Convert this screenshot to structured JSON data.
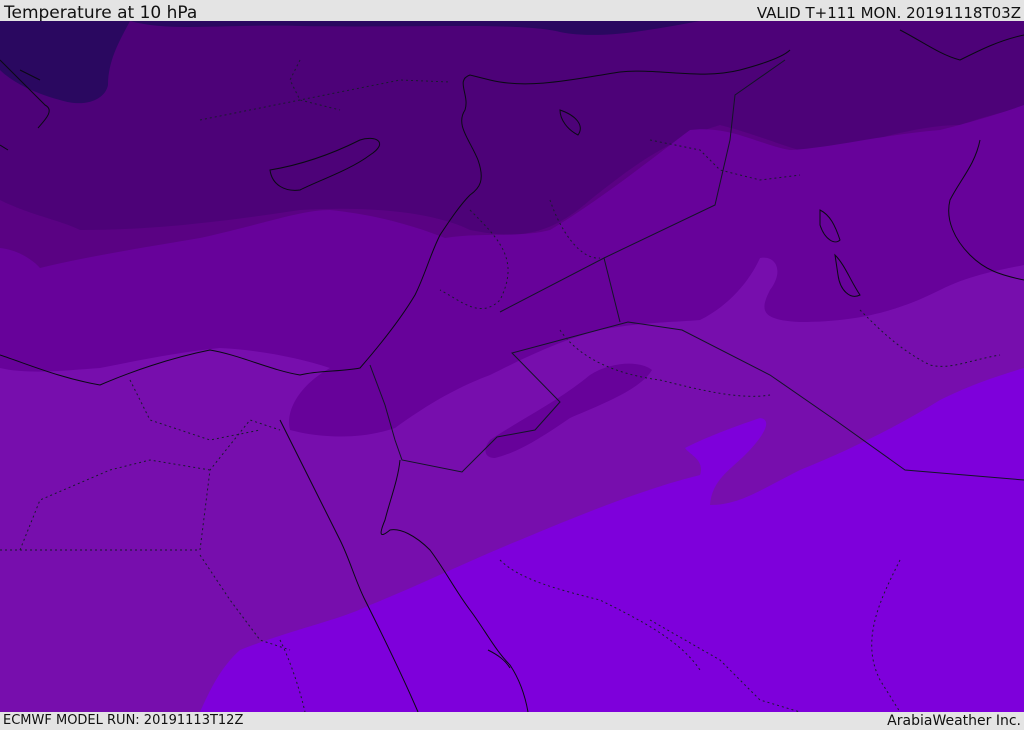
{
  "header": {
    "title": "Temperature at 10 hPa",
    "valid": "VALID T+111 MON. 20191118T03Z"
  },
  "footer": {
    "model_run": "ECMWF MODEL RUN: 20191113T12Z",
    "credit": "ArabiaWeather Inc."
  },
  "colors": {
    "darkest": "#2a0860",
    "band1": "#4d0278",
    "band2": "#5a0283",
    "band3": "#67029a",
    "band4": "#770ead",
    "band5": "#7e00db",
    "coast": "#0a0a14",
    "border": "#141428"
  }
}
